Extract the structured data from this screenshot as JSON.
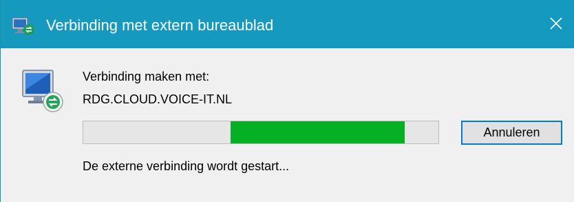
{
  "window": {
    "title": "Verbinding met extern bureaublad",
    "close_label": "✕"
  },
  "dialog": {
    "connecting_label": "Verbinding maken met:",
    "host": "RDG.CLOUD.VOICE-IT.NL",
    "progress": {
      "segment_start_fraction": 0.415,
      "segment_end_fraction": 0.905,
      "color": "#06b025"
    },
    "cancel_label": "Annuleren",
    "status": "De externe verbinding wordt gestart..."
  },
  "icons": {
    "app": "remote-desktop-icon",
    "monitor": "remote-desktop-monitor-icon",
    "close": "close-icon"
  },
  "colors": {
    "titlebar": "#1599be",
    "accent": "#0078d7"
  }
}
